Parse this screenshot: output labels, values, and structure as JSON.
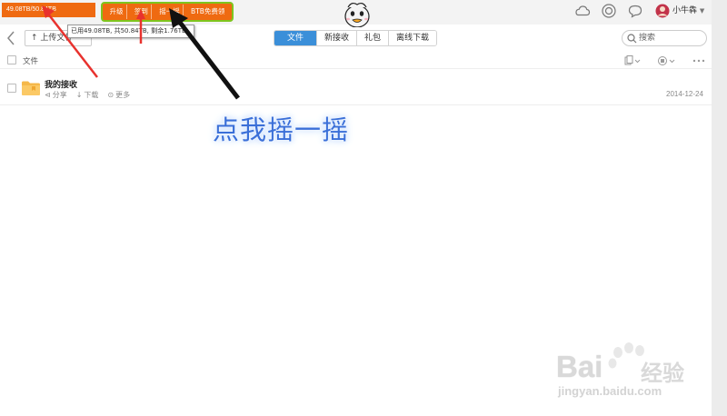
{
  "topbar": {
    "quota": "49.08TB/50.84TB",
    "links": [
      "升级",
      "签到",
      "摇一摇",
      "BTB免费领"
    ],
    "username": "小牛犇"
  },
  "toolbar": {
    "upload_label": "上传文件",
    "tooltip": "已用49.08TB, 共50.84TB, 剩余1.76TB",
    "tabs": [
      "文件",
      "新接收",
      "礼包",
      "离线下载"
    ],
    "active_tab": "文件",
    "search_placeholder": "搜索"
  },
  "list": {
    "column_name": "文件",
    "rows": [
      {
        "name": "我的接收",
        "actions": [
          "分享",
          "下载",
          "更多"
        ],
        "date": "2014-12-24"
      }
    ]
  },
  "annotation": {
    "callout": "点我摇一摇",
    "colors": {
      "arrow_red": "#e8322e",
      "arrow_black": "#111111",
      "callout_blue": "#3a6fd8",
      "highlight_green": "#7ec51f",
      "accent_orange": "#ef6a11"
    }
  },
  "watermark": {
    "brand": "Bai",
    "brand_cn": "经验",
    "url": "jingyan.baidu.com"
  },
  "icons": [
    "cloud-icon",
    "target-icon",
    "chat-icon",
    "avatar",
    "search-icon",
    "folder-icon",
    "share-icon",
    "download-icon",
    "more-icon",
    "back-icon",
    "upload-icon",
    "copy-icon",
    "view-icon",
    "menu-dots-icon"
  ]
}
